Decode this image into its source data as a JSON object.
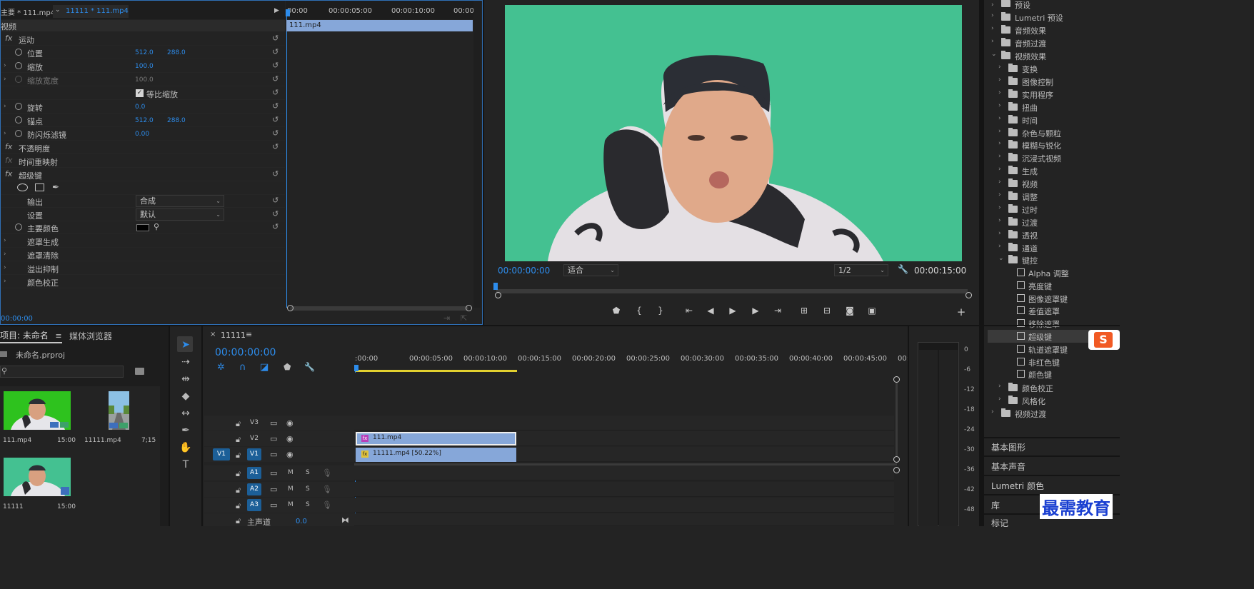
{
  "effect_controls": {
    "source_tab": "主要 * 111.mp4",
    "sequence_tab": "11111 * 111.mp4",
    "video_header": "视频",
    "timecode": "00:00:00",
    "ruler": [
      "00:00",
      "00:00:05:00",
      "00:00:10:00",
      "00:00"
    ],
    "clip_label": "111.mp4",
    "motion": "运动",
    "position": {
      "label": "位置",
      "x": "512.0",
      "y": "288.0"
    },
    "scale": {
      "label": "缩放",
      "value": "100.0"
    },
    "scale_width": {
      "label": "缩放宽度",
      "value": "100.0"
    },
    "uniform_scale": "等比缩放",
    "rotation": {
      "label": "旋转",
      "value": "0.0"
    },
    "anchor": {
      "label": "锚点",
      "x": "512.0",
      "y": "288.0"
    },
    "antiflicker": {
      "label": "防闪烁滤镜",
      "value": "0.00"
    },
    "opacity": "不透明度",
    "time_remap": "时间重映射",
    "ultra_key": "超级键",
    "output": {
      "label": "输出",
      "value": "合成"
    },
    "setting": {
      "label": "设置",
      "value": "默认"
    },
    "key_color": {
      "label": "主要颜色",
      "color": "#000000"
    },
    "matte_gen": "遮罩生成",
    "matte_cleanup": "遮罩清除",
    "spill": "溢出抑制",
    "color_correction": "颜色校正"
  },
  "program": {
    "bg_color": "#44c191",
    "timecode": "00:00:00:00",
    "fit": "适合",
    "resolution": "1/2",
    "duration": "00:00:15:00"
  },
  "project": {
    "tab_project": "项目: 未命名",
    "tab_media": "媒体浏览器",
    "file": "未命名.prproj",
    "items": [
      {
        "name": "111.mp4",
        "duration": "15:00"
      },
      {
        "name": "11111.mp4",
        "duration": "7;15"
      },
      {
        "name": "11111",
        "duration": "15:00"
      }
    ]
  },
  "timeline": {
    "tab": "11111",
    "timecode": "00:00:00:00",
    "ruler": [
      ":00:00",
      "00:00:05:00",
      "00:00:10:00",
      "00:00:15:00",
      "00:00:20:00",
      "00:00:25:00",
      "00:00:30:00",
      "00:00:35:00",
      "00:00:40:00",
      "00:00:45:00",
      "00:0"
    ],
    "tracks_video": [
      "V3",
      "V2",
      "V1"
    ],
    "tracks_audio": [
      "A1",
      "A2",
      "A3"
    ],
    "source_patch": "V1",
    "master": "主声道",
    "master_value": "0.0",
    "clip_v2": "111.mp4",
    "clip_v1": "11111.mp4 [50.22%]",
    "m": "M",
    "s": "S"
  },
  "meter_labels": [
    "0",
    "-6",
    "-12",
    "-18",
    "-24",
    "-30",
    "-36",
    "-42",
    "-48"
  ],
  "effects_tree": {
    "presets": "预设",
    "lumetri_presets": "Lumetri 预设",
    "audio_effects": "音频效果",
    "audio_transitions": "音频过渡",
    "video_effects": "视频效果",
    "categories": [
      "变换",
      "图像控制",
      "实用程序",
      "扭曲",
      "时间",
      "杂色与颗粒",
      "模糊与锐化",
      "沉浸式视频",
      "生成",
      "视频",
      "调整",
      "过时",
      "过渡",
      "透视",
      "通道"
    ],
    "keying": "键控",
    "keying_items": [
      "Alpha 调整",
      "亮度键",
      "图像遮罩键",
      "差值遮罩",
      "移除遮罩",
      "超级键",
      "轨道遮罩键",
      "非红色键",
      "颜色键"
    ],
    "after": [
      "颜色校正",
      "风格化"
    ],
    "video_transitions": "视频过渡"
  },
  "side_panels": [
    "基本图形",
    "基本声音",
    "Lumetri 颜色",
    "库",
    "标记"
  ],
  "watermark": "最需教育"
}
